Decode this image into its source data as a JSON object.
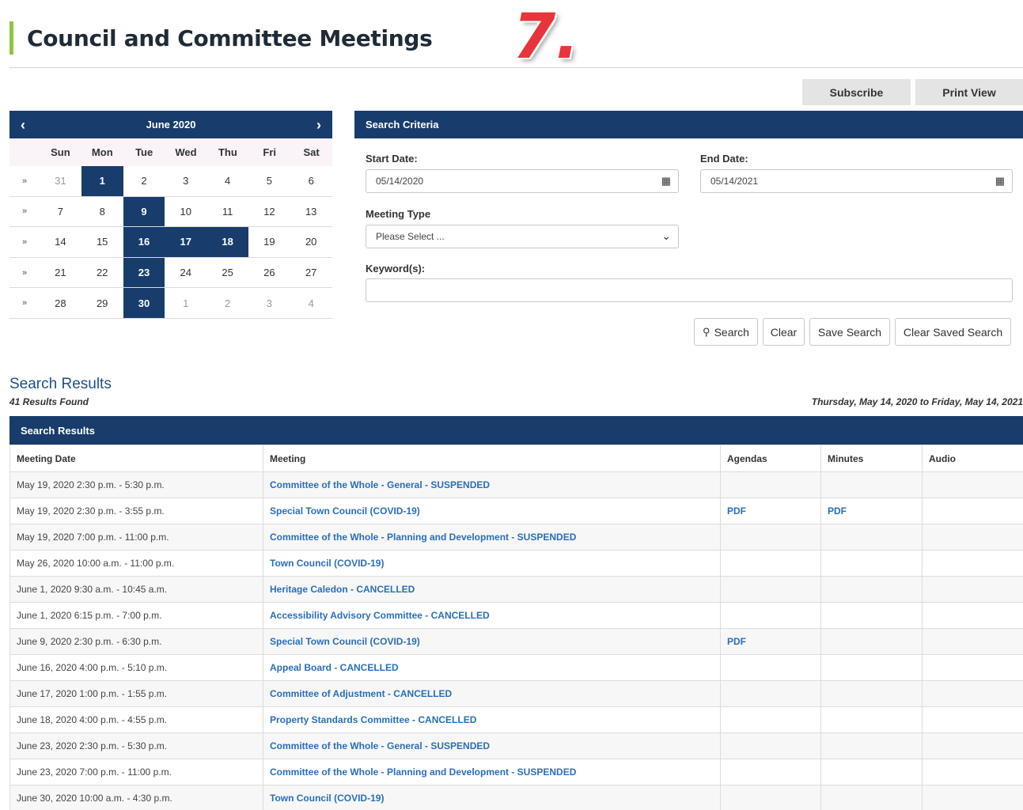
{
  "page": {
    "title": "Council and Committee Meetings",
    "badge": "7."
  },
  "top_buttons": {
    "subscribe": "Subscribe",
    "print": "Print View"
  },
  "calendar": {
    "prev": "‹",
    "next": "›",
    "month": "June 2020",
    "days_of_week": [
      "Sun",
      "Mon",
      "Tue",
      "Wed",
      "Thu",
      "Fri",
      "Sat"
    ],
    "week_marker": "»",
    "weeks": [
      [
        "31",
        "1",
        "2",
        "3",
        "4",
        "5",
        "6"
      ],
      [
        "7",
        "8",
        "9",
        "10",
        "11",
        "12",
        "13"
      ],
      [
        "14",
        "15",
        "16",
        "17",
        "18",
        "19",
        "20"
      ],
      [
        "21",
        "22",
        "23",
        "24",
        "25",
        "26",
        "27"
      ],
      [
        "28",
        "29",
        "30",
        "1",
        "2",
        "3",
        "4"
      ]
    ],
    "highlighted_days": [
      "1",
      "9",
      "16",
      "17",
      "18",
      "23",
      "30"
    ]
  },
  "criteria": {
    "header": "Search Criteria",
    "start_label": "Start Date:",
    "start_value": "05/14/2020",
    "end_label": "End Date:",
    "end_value": "05/14/2021",
    "type_label": "Meeting Type",
    "type_value": "Please Select ...",
    "keyword_label": "Keyword(s):",
    "keyword_value": "",
    "buttons": {
      "search": "Search",
      "clear": "Clear",
      "save": "Save Search",
      "clear_saved": "Clear Saved Search"
    }
  },
  "results": {
    "title": "Search Results",
    "count": "41 Results Found",
    "range": "Thursday, May 14, 2020 to Friday, May 14, 2021",
    "header": "Search Results",
    "columns": [
      "Meeting Date",
      "Meeting",
      "Agendas",
      "Minutes",
      "Audio"
    ],
    "rows": [
      {
        "date": "May 19, 2020 2:30 p.m. - 5:30 p.m.",
        "meeting": "Committee of the Whole - General - SUSPENDED",
        "agendas": "",
        "minutes": "",
        "audio": ""
      },
      {
        "date": "May 19, 2020 2:30 p.m. - 3:55 p.m.",
        "meeting": "Special Town Council (COVID-19)",
        "agendas": "PDF",
        "minutes": "PDF",
        "audio": ""
      },
      {
        "date": "May 19, 2020 7:00 p.m. - 11:00 p.m.",
        "meeting": "Committee of the Whole - Planning and Development - SUSPENDED",
        "agendas": "",
        "minutes": "",
        "audio": ""
      },
      {
        "date": "May 26, 2020 10:00 a.m. - 11:00 p.m.",
        "meeting": "Town Council (COVID-19)",
        "agendas": "",
        "minutes": "",
        "audio": ""
      },
      {
        "date": "June 1, 2020 9:30 a.m. - 10:45 a.m.",
        "meeting": "Heritage Caledon - CANCELLED",
        "agendas": "",
        "minutes": "",
        "audio": ""
      },
      {
        "date": "June 1, 2020 6:15 p.m. - 7:00 p.m.",
        "meeting": "Accessibility Advisory Committee - CANCELLED",
        "agendas": "",
        "minutes": "",
        "audio": ""
      },
      {
        "date": "June 9, 2020 2:30 p.m. - 6:30 p.m.",
        "meeting": "Special Town Council (COVID-19)",
        "agendas": "PDF",
        "minutes": "",
        "audio": ""
      },
      {
        "date": "June 16, 2020 4:00 p.m. - 5:10 p.m.",
        "meeting": "Appeal Board - CANCELLED",
        "agendas": "",
        "minutes": "",
        "audio": ""
      },
      {
        "date": "June 17, 2020 1:00 p.m. - 1:55 p.m.",
        "meeting": "Committee of Adjustment - CANCELLED",
        "agendas": "",
        "minutes": "",
        "audio": ""
      },
      {
        "date": "June 18, 2020 4:00 p.m. - 4:55 p.m.",
        "meeting": "Property Standards Committee - CANCELLED",
        "agendas": "",
        "minutes": "",
        "audio": ""
      },
      {
        "date": "June 23, 2020 2:30 p.m. - 5:30 p.m.",
        "meeting": "Committee of the Whole - General - SUSPENDED",
        "agendas": "",
        "minutes": "",
        "audio": ""
      },
      {
        "date": "June 23, 2020 7:00 p.m. - 11:00 p.m.",
        "meeting": "Committee of the Whole - Planning and Development - SUSPENDED",
        "agendas": "",
        "minutes": "",
        "audio": ""
      },
      {
        "date": "June 30, 2020 10:00 a.m. - 4:30 p.m.",
        "meeting": "Town Council (COVID-19)",
        "agendas": "",
        "minutes": "",
        "audio": ""
      }
    ]
  }
}
